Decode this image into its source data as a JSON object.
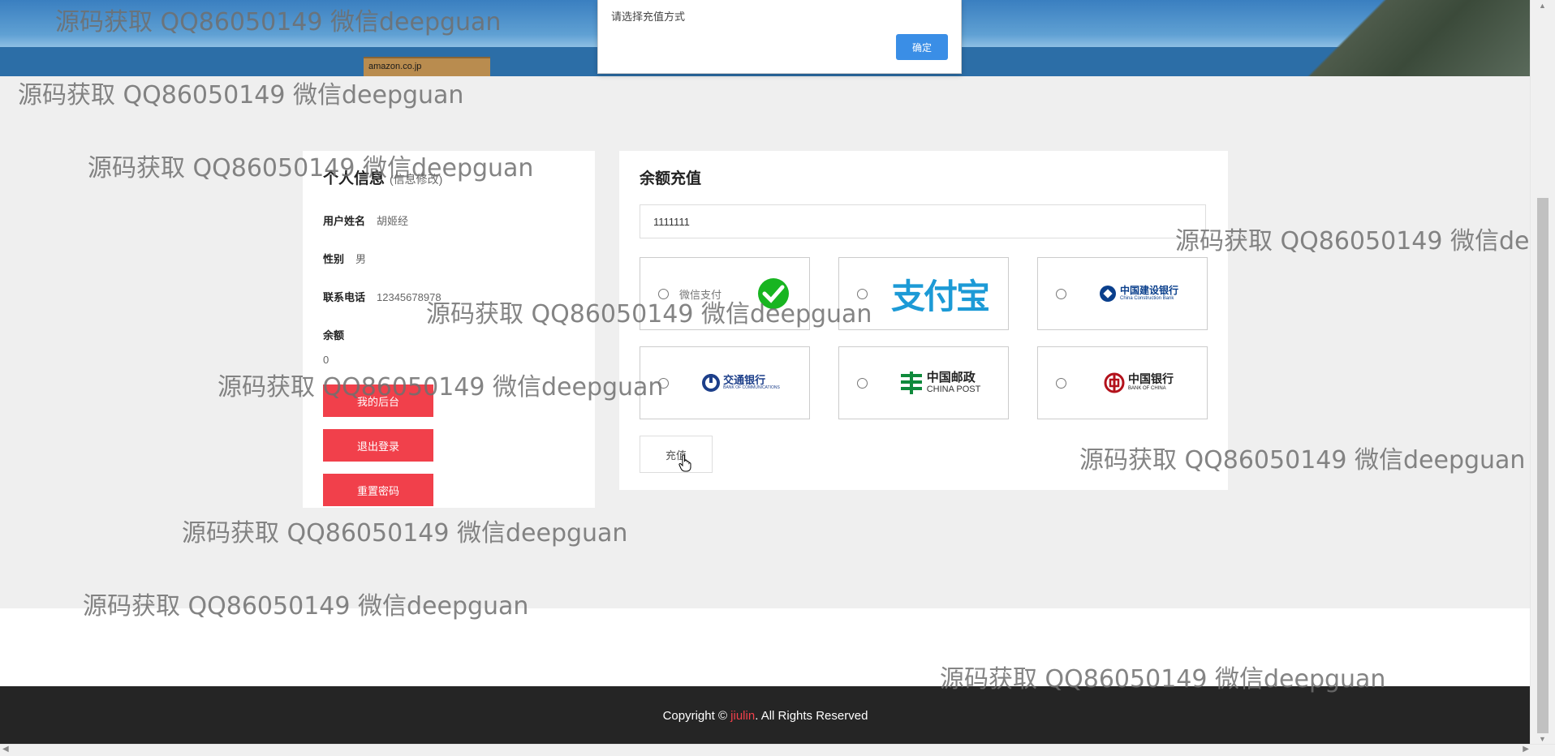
{
  "banner": {
    "box_text": "amazon.co.jp"
  },
  "alert": {
    "message": "请选择充值方式",
    "ok_label": "确定"
  },
  "profile": {
    "title": "个人信息",
    "edit_link": "(信息修改)",
    "username_label": "用户姓名",
    "username": "胡姬经",
    "gender_label": "性别",
    "gender": "男",
    "phone_label": "联系电话",
    "phone": "12345678978",
    "balance_label": "余额",
    "balance": "0",
    "buttons": {
      "backend": "我的后台",
      "logout": "退出登录",
      "reset_password": "重置密码"
    }
  },
  "recharge": {
    "title": "余额充值",
    "amount_value": "1111111",
    "methods": [
      {
        "name": "微信支付",
        "icon": "wechat-pay-icon"
      },
      {
        "name": "支付宝",
        "icon": "alipay-icon"
      },
      {
        "name": "中国建设银行",
        "sub": "China Construction Bank",
        "icon": "ccb-icon"
      },
      {
        "name": "交通银行",
        "sub": "BANK OF COMMUNICATIONS",
        "icon": "bocom-icon"
      },
      {
        "name": "中国邮政",
        "sub": "CHINA POST",
        "icon": "china-post-icon"
      },
      {
        "name": "中国银行",
        "sub": "BANK OF CHINA",
        "icon": "boc-icon"
      }
    ],
    "submit_label": "充值"
  },
  "footer": {
    "prefix": "Copyright © ",
    "brand": "jiulin",
    "suffix": ". All Rights Reserved"
  },
  "watermark": "源码获取 QQ86050149 微信deepguan",
  "colors": {
    "accent_red": "#f1404b",
    "alert_blue": "#3a8ee6",
    "footer_bg": "#252525"
  }
}
